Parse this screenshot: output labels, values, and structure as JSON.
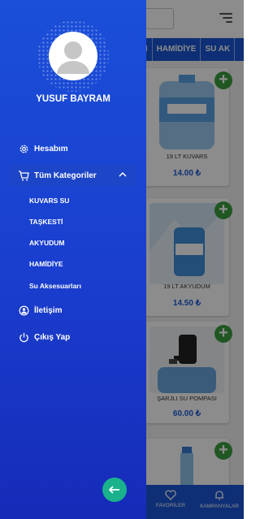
{
  "user": {
    "name": "YUSUF BAYRAM"
  },
  "menu": {
    "account": "Hesabım",
    "categories": "Tüm Kategoriler",
    "subcategories": [
      "KUVARS SU",
      "TAŞKESTİ",
      "AKYUDUM",
      "HAMİDİYE",
      "Su Aksesuarları"
    ],
    "contact": "İletişim",
    "logout": "Çıkış Yap"
  },
  "background": {
    "category_tabs": [
      "UM",
      "HAMİDİYE",
      "SU AK"
    ],
    "products": [
      {
        "name": "19 LT KUVARS",
        "price": "14.00 ₺"
      },
      {
        "name": "19 LT AKYUDUM",
        "price": "14.50 ₺"
      },
      {
        "name": "ŞARJLI SU POMPASI",
        "price": "60.00 ₺"
      },
      {
        "name": "",
        "price": ""
      }
    ],
    "bottom_nav": [
      "FAVORİLER",
      "KAMPANYALAR"
    ]
  },
  "colors": {
    "drawer": "#1a4fd8",
    "accent": "#1b56d6",
    "add": "#3b9d3e",
    "back": "#19b28d"
  },
  "icons": [
    "gear-icon",
    "cart-icon",
    "chevron-up-icon",
    "contact-icon",
    "power-icon",
    "arrow-left-icon",
    "heart-icon",
    "bell-icon",
    "menu-icon"
  ]
}
